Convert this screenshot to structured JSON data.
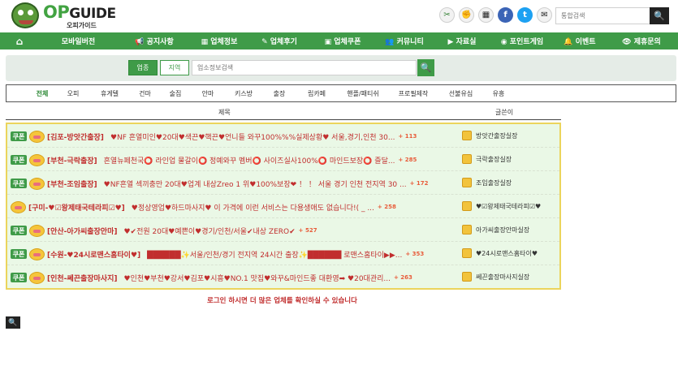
{
  "logo": {
    "op": "OP",
    "guide": "GUIDE",
    "subtitle": "오피가이드"
  },
  "top_icons": [
    {
      "icon": "sparkle-cut-icon",
      "glyph": "✂"
    },
    {
      "icon": "fist-icon",
      "glyph": "✊"
    },
    {
      "icon": "card-icon",
      "glyph": "▦"
    },
    {
      "icon": "facebook-icon",
      "glyph": "f"
    },
    {
      "icon": "twitter-icon",
      "glyph": "t"
    },
    {
      "icon": "mail-icon",
      "glyph": "✉"
    }
  ],
  "search": {
    "placeholder": "통합검색"
  },
  "nav": [
    {
      "label": "⌂",
      "icon": "home-icon"
    },
    {
      "label": "모바일버전"
    },
    {
      "label": "📢 공지사항"
    },
    {
      "label": "▦ 업체정보"
    },
    {
      "label": "✎ 업체후기"
    },
    {
      "label": "▣ 업체쿠폰"
    },
    {
      "label": "👥 커뮤니티"
    },
    {
      "label": "▶ 자료실"
    },
    {
      "label": "◉ 포인트게임"
    },
    {
      "label": "🔔 이벤트"
    },
    {
      "label": "👁 제휴문의"
    }
  ],
  "filter": {
    "biz": "업종",
    "region": "지역",
    "placeholder": "업소정보검색"
  },
  "categories": [
    "전체",
    "오피",
    "휴게텔",
    "건마",
    "술집",
    "안마",
    "키스방",
    "출장",
    "립카페",
    "핸플/패티쉬",
    "프로필제작",
    "선불유심",
    "유흥"
  ],
  "table_header": {
    "title": "제목",
    "writer": "글쓴이"
  },
  "rows": [
    {
      "tag": "쿠폰",
      "store": "[김포-방앗간출장]",
      "title": "♥NF 흔열미인♥20대♥색끈♥핵끈♥언니들 와꾸100%%%실제상황♥ 서울,경기,인천 30...",
      "count": "+ 113",
      "writer": "방앗간출장실장"
    },
    {
      "tag": "쿠폰",
      "store": "[부천-극락출장]",
      "title": "흔열뉴페천국⭕ 라인업 물갈이⭕ 정예와꾸 멤버⭕ 사이즈실사100%⭕ 마인드보장⭕ 즐달...",
      "count": "+ 285",
      "writer": "극락출장실장"
    },
    {
      "tag": "쿠폰",
      "store": "[부천-조임출장]",
      "title": "♥NF흔열 섹끼충만 20대♥업계 내상Zreo 1 위♥100%보장❤ ！ ！ 서울 경기 인천 전지역 30 ...",
      "count": "+ 172",
      "writer": "조임출장실장"
    },
    {
      "tag": "",
      "store": "[구미-♥☑왕제태국테라피☑♥]",
      "title": "♥정상영업♥하드마사지♥ 이 가격에 이런 서비스는 다용생애도 없습니다!( _ ...",
      "count": "+ 258",
      "writer": "♥☑왕제태국테라피☑♥"
    },
    {
      "tag": "쿠폰",
      "store": "[안산-아가씨출장안마]",
      "title": "♥✔전원 20대♥예쁜이♥경기/인천/서울✔내상 ZERO✔",
      "count": "+ 527",
      "writer": "아가씨출장안마실장"
    },
    {
      "tag": "쿠폰",
      "store": "[수원-♥24시로맨스홈타이♥]",
      "title": "██████✨서울/인천/경기 전지역 24시간 출장✨██████ 로맨스홈타이▶▶...",
      "count": "+ 353",
      "writer": "♥24시로맨스홈타이♥"
    },
    {
      "tag": "쿠폰",
      "store": "[인천-쎄끈출장마사지]",
      "title": "♥인천♥부천♥강서♥김포♥시흥♥NO.1 맛집♥와꾸&마인드좋 대환영➡ ♥20대관리...",
      "count": "+ 263",
      "writer": "쎄끈출장마사지실장"
    }
  ],
  "notice": "로그인 하시면 더 많은 업체를 확인하실 수 있습니다",
  "bottom_search": {
    "icon": "search-icon"
  }
}
